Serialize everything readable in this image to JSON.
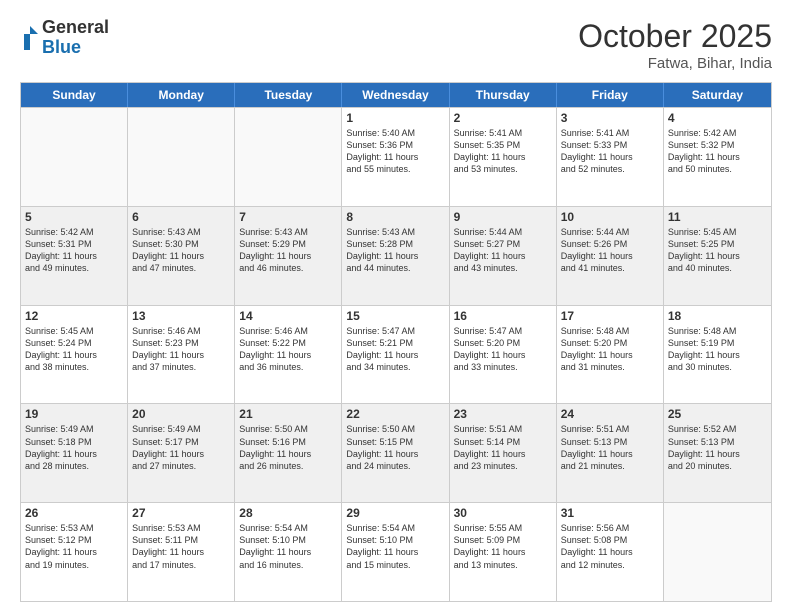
{
  "logo": {
    "general": "General",
    "blue": "Blue"
  },
  "header": {
    "month": "October 2025",
    "location": "Fatwa, Bihar, India"
  },
  "days": [
    "Sunday",
    "Monday",
    "Tuesday",
    "Wednesday",
    "Thursday",
    "Friday",
    "Saturday"
  ],
  "rows": [
    [
      {
        "day": "",
        "info": ""
      },
      {
        "day": "",
        "info": ""
      },
      {
        "day": "",
        "info": ""
      },
      {
        "day": "1",
        "info": "Sunrise: 5:40 AM\nSunset: 5:36 PM\nDaylight: 11 hours\nand 55 minutes."
      },
      {
        "day": "2",
        "info": "Sunrise: 5:41 AM\nSunset: 5:35 PM\nDaylight: 11 hours\nand 53 minutes."
      },
      {
        "day": "3",
        "info": "Sunrise: 5:41 AM\nSunset: 5:33 PM\nDaylight: 11 hours\nand 52 minutes."
      },
      {
        "day": "4",
        "info": "Sunrise: 5:42 AM\nSunset: 5:32 PM\nDaylight: 11 hours\nand 50 minutes."
      }
    ],
    [
      {
        "day": "5",
        "info": "Sunrise: 5:42 AM\nSunset: 5:31 PM\nDaylight: 11 hours\nand 49 minutes."
      },
      {
        "day": "6",
        "info": "Sunrise: 5:43 AM\nSunset: 5:30 PM\nDaylight: 11 hours\nand 47 minutes."
      },
      {
        "day": "7",
        "info": "Sunrise: 5:43 AM\nSunset: 5:29 PM\nDaylight: 11 hours\nand 46 minutes."
      },
      {
        "day": "8",
        "info": "Sunrise: 5:43 AM\nSunset: 5:28 PM\nDaylight: 11 hours\nand 44 minutes."
      },
      {
        "day": "9",
        "info": "Sunrise: 5:44 AM\nSunset: 5:27 PM\nDaylight: 11 hours\nand 43 minutes."
      },
      {
        "day": "10",
        "info": "Sunrise: 5:44 AM\nSunset: 5:26 PM\nDaylight: 11 hours\nand 41 minutes."
      },
      {
        "day": "11",
        "info": "Sunrise: 5:45 AM\nSunset: 5:25 PM\nDaylight: 11 hours\nand 40 minutes."
      }
    ],
    [
      {
        "day": "12",
        "info": "Sunrise: 5:45 AM\nSunset: 5:24 PM\nDaylight: 11 hours\nand 38 minutes."
      },
      {
        "day": "13",
        "info": "Sunrise: 5:46 AM\nSunset: 5:23 PM\nDaylight: 11 hours\nand 37 minutes."
      },
      {
        "day": "14",
        "info": "Sunrise: 5:46 AM\nSunset: 5:22 PM\nDaylight: 11 hours\nand 36 minutes."
      },
      {
        "day": "15",
        "info": "Sunrise: 5:47 AM\nSunset: 5:21 PM\nDaylight: 11 hours\nand 34 minutes."
      },
      {
        "day": "16",
        "info": "Sunrise: 5:47 AM\nSunset: 5:20 PM\nDaylight: 11 hours\nand 33 minutes."
      },
      {
        "day": "17",
        "info": "Sunrise: 5:48 AM\nSunset: 5:20 PM\nDaylight: 11 hours\nand 31 minutes."
      },
      {
        "day": "18",
        "info": "Sunrise: 5:48 AM\nSunset: 5:19 PM\nDaylight: 11 hours\nand 30 minutes."
      }
    ],
    [
      {
        "day": "19",
        "info": "Sunrise: 5:49 AM\nSunset: 5:18 PM\nDaylight: 11 hours\nand 28 minutes."
      },
      {
        "day": "20",
        "info": "Sunrise: 5:49 AM\nSunset: 5:17 PM\nDaylight: 11 hours\nand 27 minutes."
      },
      {
        "day": "21",
        "info": "Sunrise: 5:50 AM\nSunset: 5:16 PM\nDaylight: 11 hours\nand 26 minutes."
      },
      {
        "day": "22",
        "info": "Sunrise: 5:50 AM\nSunset: 5:15 PM\nDaylight: 11 hours\nand 24 minutes."
      },
      {
        "day": "23",
        "info": "Sunrise: 5:51 AM\nSunset: 5:14 PM\nDaylight: 11 hours\nand 23 minutes."
      },
      {
        "day": "24",
        "info": "Sunrise: 5:51 AM\nSunset: 5:13 PM\nDaylight: 11 hours\nand 21 minutes."
      },
      {
        "day": "25",
        "info": "Sunrise: 5:52 AM\nSunset: 5:13 PM\nDaylight: 11 hours\nand 20 minutes."
      }
    ],
    [
      {
        "day": "26",
        "info": "Sunrise: 5:53 AM\nSunset: 5:12 PM\nDaylight: 11 hours\nand 19 minutes."
      },
      {
        "day": "27",
        "info": "Sunrise: 5:53 AM\nSunset: 5:11 PM\nDaylight: 11 hours\nand 17 minutes."
      },
      {
        "day": "28",
        "info": "Sunrise: 5:54 AM\nSunset: 5:10 PM\nDaylight: 11 hours\nand 16 minutes."
      },
      {
        "day": "29",
        "info": "Sunrise: 5:54 AM\nSunset: 5:10 PM\nDaylight: 11 hours\nand 15 minutes."
      },
      {
        "day": "30",
        "info": "Sunrise: 5:55 AM\nSunset: 5:09 PM\nDaylight: 11 hours\nand 13 minutes."
      },
      {
        "day": "31",
        "info": "Sunrise: 5:56 AM\nSunset: 5:08 PM\nDaylight: 11 hours\nand 12 minutes."
      },
      {
        "day": "",
        "info": ""
      }
    ]
  ]
}
